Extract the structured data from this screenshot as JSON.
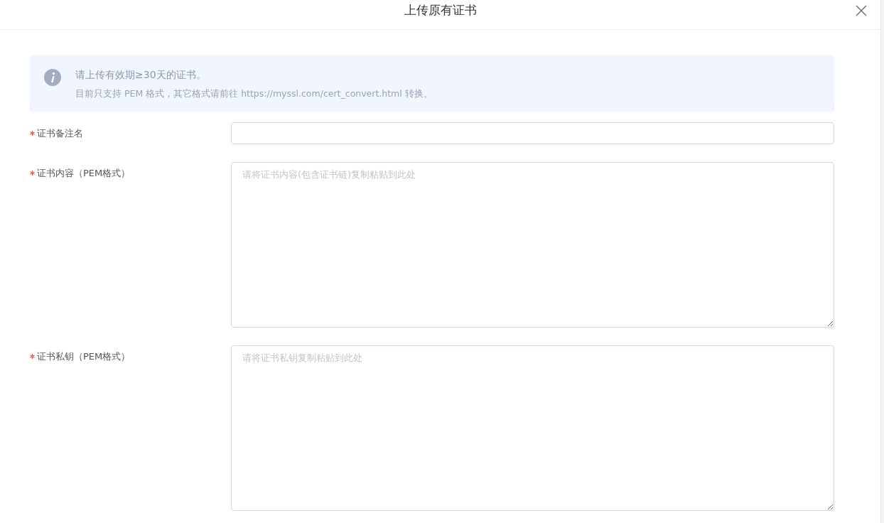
{
  "dialog": {
    "title": "上传原有证书"
  },
  "notice": {
    "title": "请上传有效期≥30天的证书。",
    "text": "目前只支持 PEM 格式，其它格式请前往 https://myssl.com/cert_convert.html 转换。"
  },
  "fields": [
    {
      "kind": "input",
      "label": "证书备注名",
      "required": true
    },
    {
      "kind": "textarea",
      "label": "证书内容（PEM格式）",
      "required": true,
      "placeholder": "请将证书内容(包含证书链)复制粘贴到此处"
    },
    {
      "kind": "textarea",
      "label": "证书私钥（PEM格式）",
      "required": true,
      "placeholder": "请将证书私钥复制粘贴到此处"
    }
  ]
}
